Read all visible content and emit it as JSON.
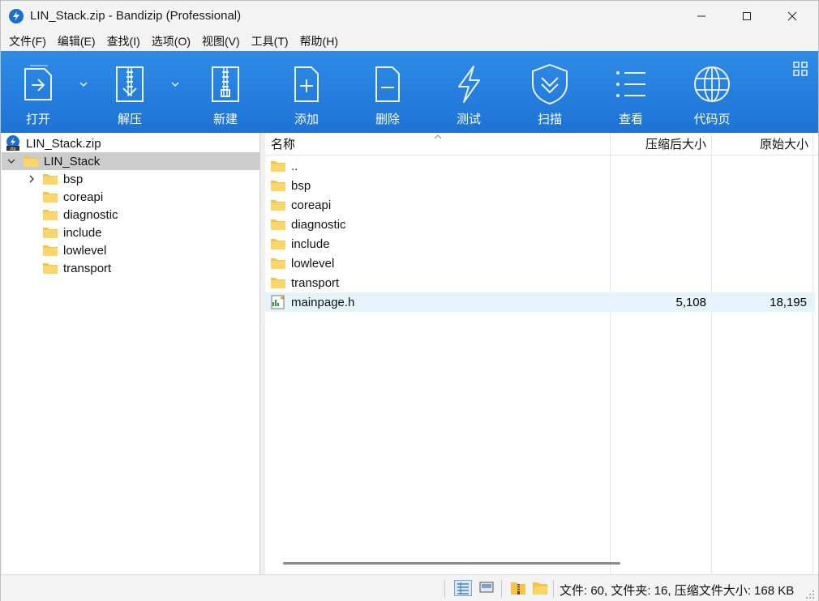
{
  "window": {
    "title": "LIN_Stack.zip - Bandizip (Professional)"
  },
  "menu": [
    "文件(F)",
    "编辑(E)",
    "查找(I)",
    "选项(O)",
    "视图(V)",
    "工具(T)",
    "帮助(H)"
  ],
  "toolbar": {
    "open": "打开",
    "extract": "解压",
    "new": "新建",
    "add": "添加",
    "delete": "删除",
    "test": "测试",
    "scan": "扫描",
    "view": "查看",
    "codepage": "代码页"
  },
  "tree": {
    "root": "LIN_Stack.zip",
    "folder": "LIN_Stack",
    "children": [
      "bsp",
      "coreapi",
      "diagnostic",
      "include",
      "lowlevel",
      "transport"
    ]
  },
  "list": {
    "columns": {
      "name": "名称",
      "packed": "压缩后大小",
      "original": "原始大小"
    },
    "rows": [
      {
        "name": "..",
        "packed": "",
        "original": ""
      },
      {
        "name": "bsp",
        "packed": "",
        "original": ""
      },
      {
        "name": "coreapi",
        "packed": "",
        "original": ""
      },
      {
        "name": "diagnostic",
        "packed": "",
        "original": ""
      },
      {
        "name": "include",
        "packed": "",
        "original": ""
      },
      {
        "name": "lowlevel",
        "packed": "",
        "original": ""
      },
      {
        "name": "transport",
        "packed": "",
        "original": ""
      },
      {
        "name": "mainpage.h",
        "packed": "5,108",
        "original": "18,195"
      }
    ]
  },
  "status": {
    "text": "文件: 60, 文件夹: 16, 压缩文件大小: 168 KB"
  },
  "colors": {
    "toolbar_top": "#2f8be6",
    "toolbar_bottom": "#1d73d5",
    "folder": "#f6c342",
    "selection": "#cccccc",
    "row_highlight": "#e5f3fb"
  }
}
